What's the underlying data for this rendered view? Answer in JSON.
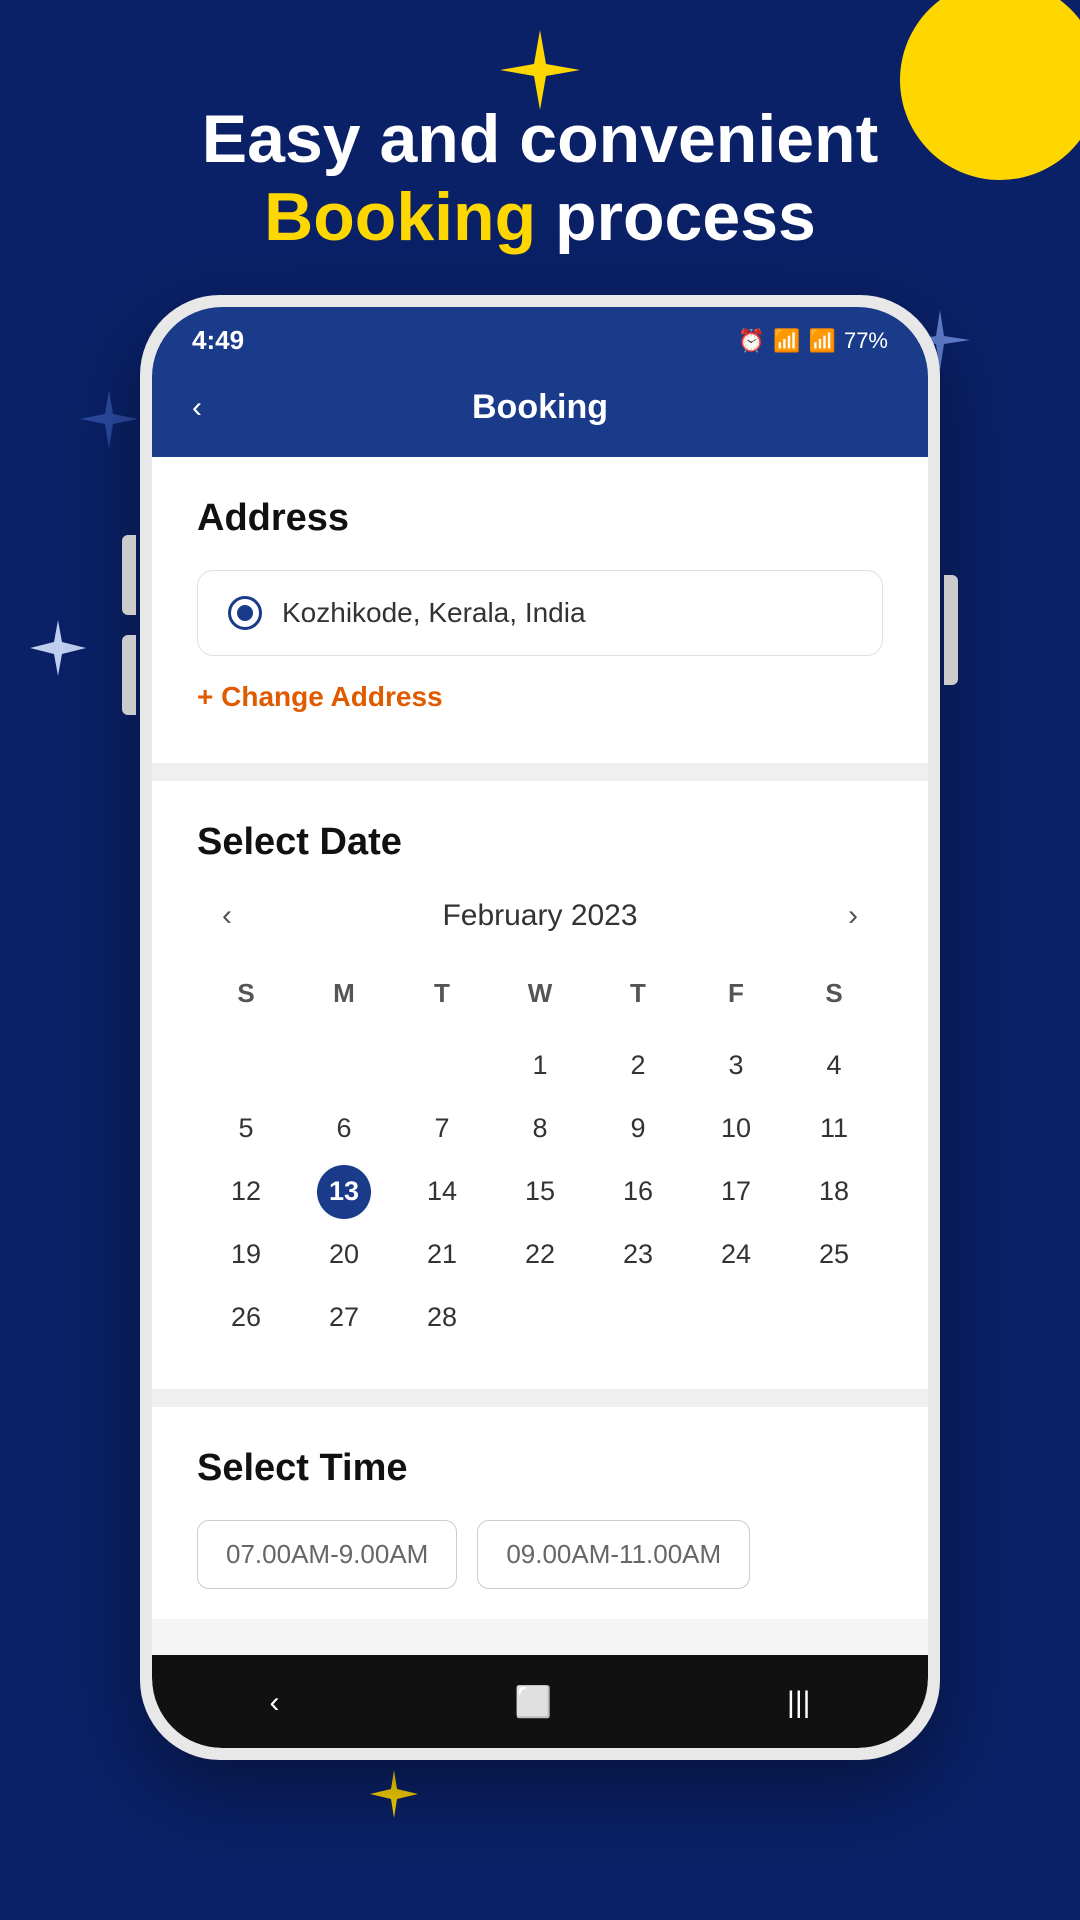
{
  "background": {
    "color": "#0a2167"
  },
  "header": {
    "line1": "Easy and convenient",
    "line2_highlight": "Booking",
    "line2_rest": " process"
  },
  "status_bar": {
    "time": "4:49",
    "battery": "77%",
    "icons": "⏰ 📶"
  },
  "app_header": {
    "title": "Booking",
    "back_label": "‹"
  },
  "address_section": {
    "title": "Address",
    "address_value": "Kozhikode, Kerala, India",
    "change_address_label": "+ Change Address"
  },
  "calendar_section": {
    "title": "Select Date",
    "month": "February 2023",
    "day_labels": [
      "S",
      "M",
      "T",
      "W",
      "T",
      "F",
      "S"
    ],
    "selected_date": 13,
    "weeks": [
      [
        null,
        null,
        null,
        1,
        2,
        3,
        4
      ],
      [
        5,
        6,
        7,
        8,
        9,
        10,
        11
      ],
      [
        12,
        13,
        14,
        15,
        16,
        17,
        18
      ],
      [
        19,
        20,
        21,
        22,
        23,
        24,
        25
      ],
      [
        26,
        27,
        28,
        null,
        null,
        null,
        null
      ]
    ],
    "prev_label": "‹",
    "next_label": "›"
  },
  "time_section": {
    "title": "Select Time",
    "slots": [
      "07.00AM-9.00AM",
      "09.00AM-11.00AM"
    ]
  },
  "bottom_nav": {
    "back_label": "‹",
    "home_label": "⬜",
    "menu_label": "|||"
  },
  "decorative": {
    "star_yellow": "✦",
    "star_blue": "✦",
    "star_white": "✦"
  }
}
